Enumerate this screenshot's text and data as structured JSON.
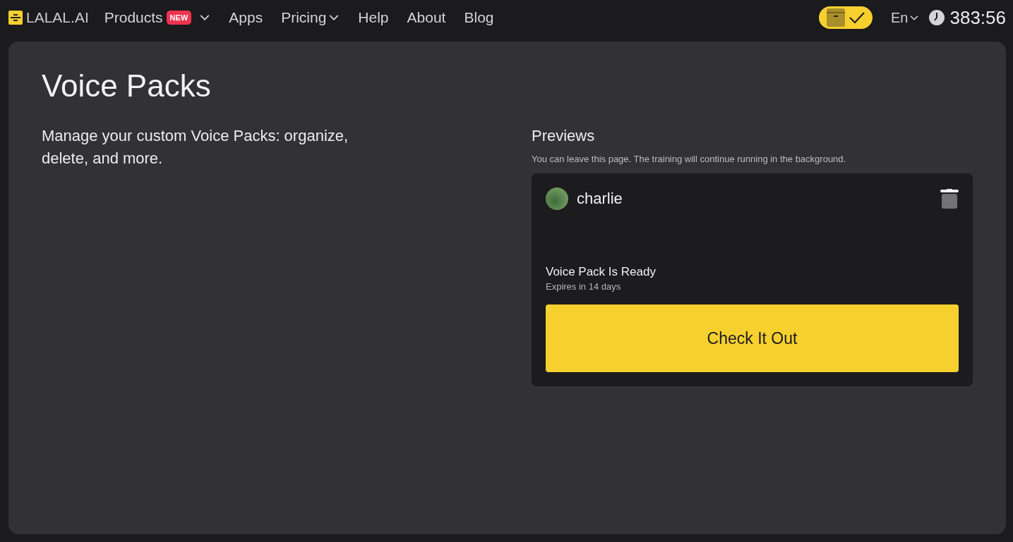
{
  "header": {
    "logo": "LALAL.AI",
    "nav": [
      {
        "label": "Products",
        "badge": "NEW",
        "has_menu": true
      },
      {
        "label": "Apps",
        "has_menu": false
      },
      {
        "label": "Pricing",
        "has_menu": true
      },
      {
        "label": "Help",
        "has_menu": false
      },
      {
        "label": "About",
        "has_menu": false
      },
      {
        "label": "Blog",
        "has_menu": false
      }
    ],
    "language": "En",
    "timer": "383:56"
  },
  "page": {
    "title": "Voice Packs",
    "description": "Manage your custom Voice Packs: organize, delete, and more.",
    "previews": {
      "heading": "Previews",
      "note": "You can leave this page. The training will continue running in the background.",
      "cards": [
        {
          "name": "charlie",
          "status": "Voice Pack Is Ready",
          "expiry": "Expires in 14 days",
          "action": "Check It Out"
        }
      ]
    }
  }
}
